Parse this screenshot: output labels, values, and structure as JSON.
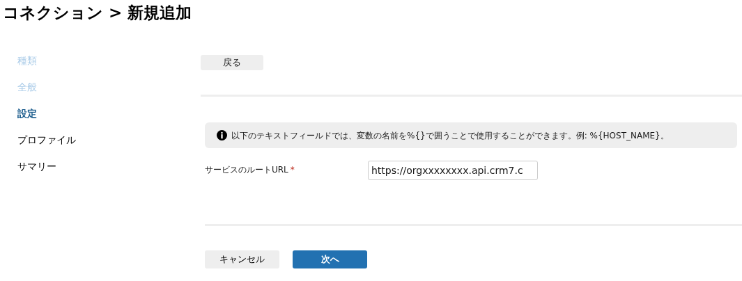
{
  "title": "コネクション > 新規追加",
  "steps": [
    {
      "label": "種類",
      "completed": true,
      "selected": false
    },
    {
      "label": "全般",
      "completed": true,
      "selected": false
    },
    {
      "label": "設定",
      "completed": false,
      "selected": true
    },
    {
      "label": "プロファイル",
      "completed": false,
      "selected": false
    },
    {
      "label": "サマリー",
      "completed": false,
      "selected": false
    }
  ],
  "back_button": "戻る",
  "info": "以下のテキストフィールドでは、変数の名前を%{}で囲うことで使用することができます。例: %{HOST_NAME}。",
  "field": {
    "label": "サービスのルートURL",
    "required": true,
    "required_mark": "*",
    "value": "https://orgxxxxxxxx.api.crm7.c"
  },
  "buttons": [
    {
      "label": "キャンセル",
      "kind": "secondary"
    },
    {
      "label": "次へ",
      "kind": "primary"
    }
  ]
}
